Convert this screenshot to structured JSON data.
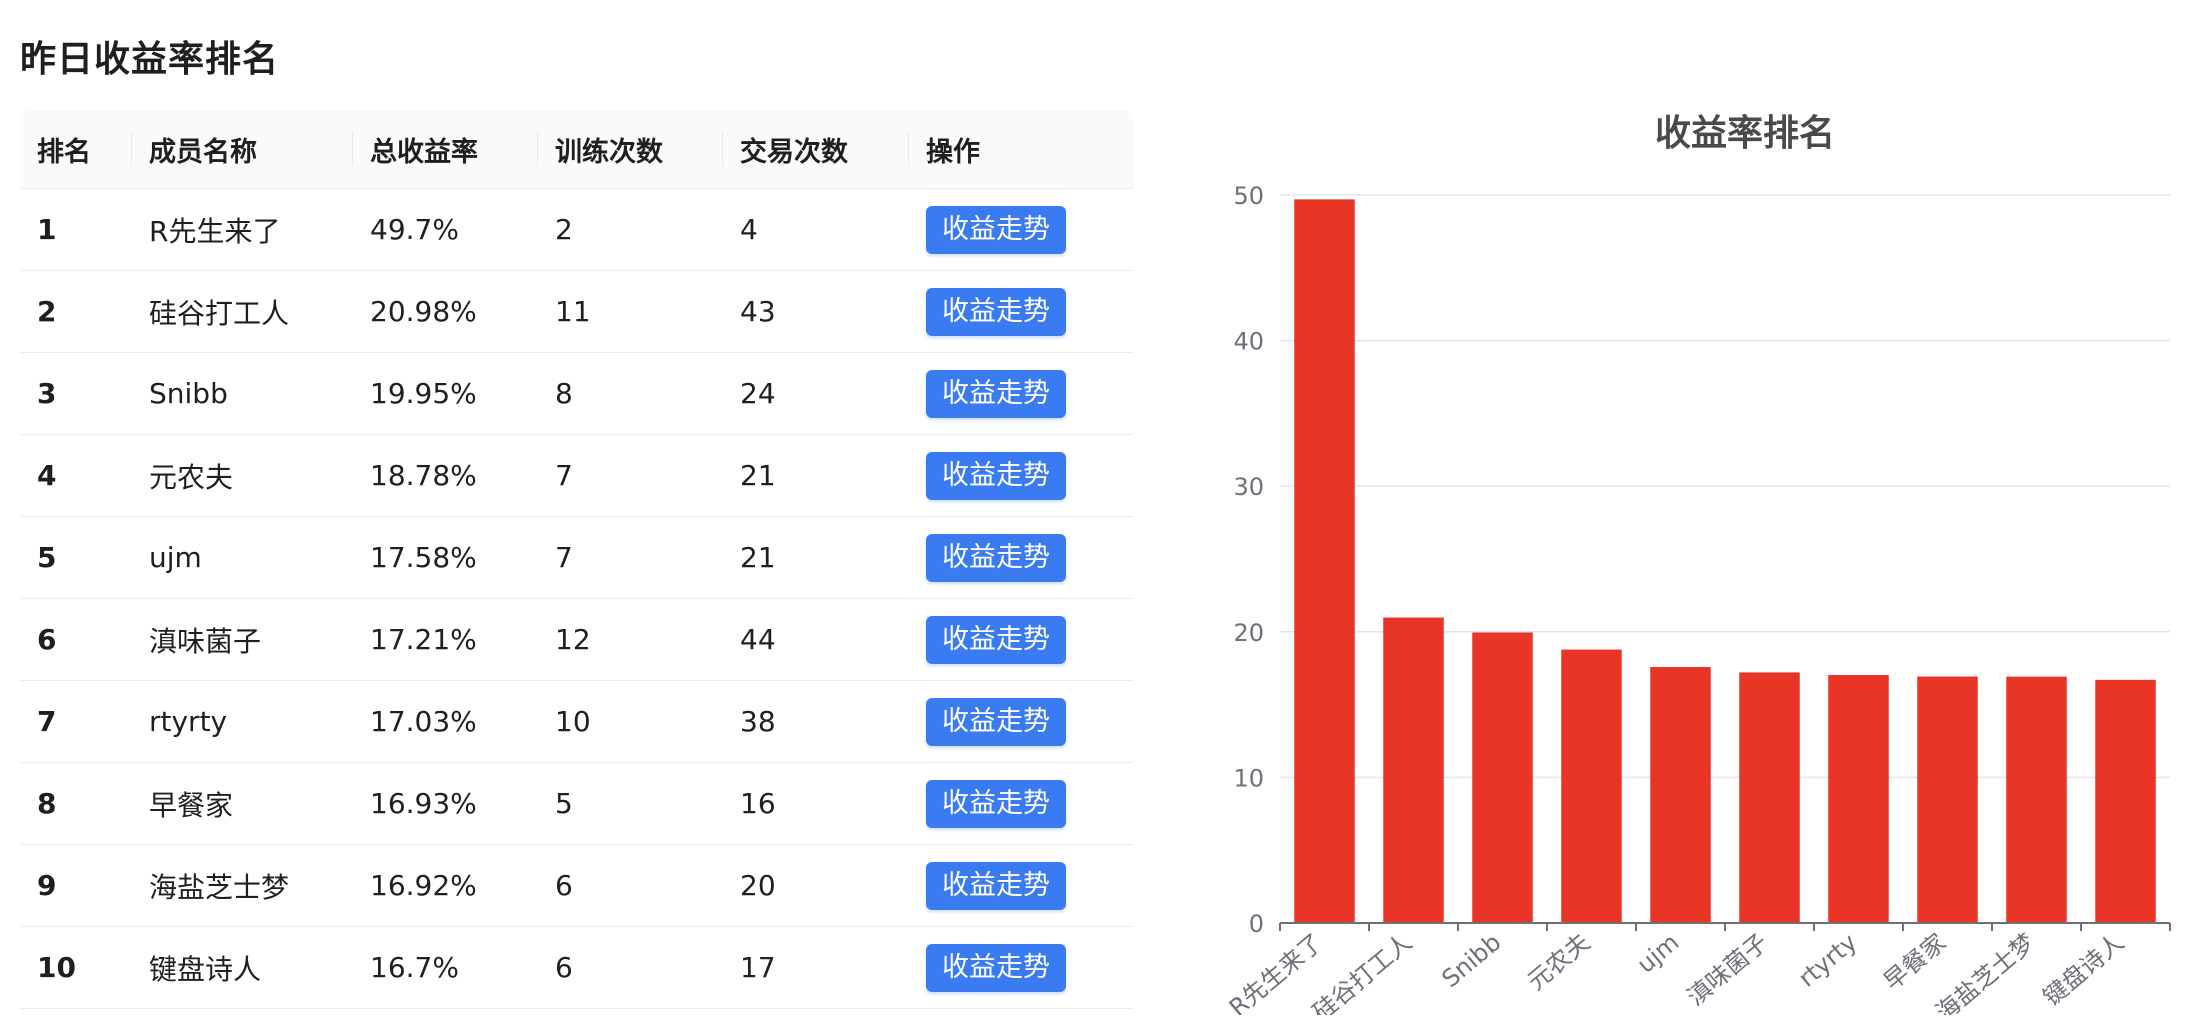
{
  "page": {
    "title": "昨日收益率排名"
  },
  "table": {
    "columns": [
      "排名",
      "成员名称",
      "总收益率",
      "训练次数",
      "交易次数",
      "操作"
    ],
    "rows": [
      {
        "rank": "1",
        "name": "R先生来了",
        "rate": "49.7%",
        "train": "2",
        "trade": "4",
        "action": "收益走势"
      },
      {
        "rank": "2",
        "name": "硅谷打工人",
        "rate": "20.98%",
        "train": "11",
        "trade": "43",
        "action": "收益走势"
      },
      {
        "rank": "3",
        "name": "Snibb",
        "rate": "19.95%",
        "train": "8",
        "trade": "24",
        "action": "收益走势"
      },
      {
        "rank": "4",
        "name": "元农夫",
        "rate": "18.78%",
        "train": "7",
        "trade": "21",
        "action": "收益走势"
      },
      {
        "rank": "5",
        "name": "ujm",
        "rate": "17.58%",
        "train": "7",
        "trade": "21",
        "action": "收益走势"
      },
      {
        "rank": "6",
        "name": "滇味菌子",
        "rate": "17.21%",
        "train": "12",
        "trade": "44",
        "action": "收益走势"
      },
      {
        "rank": "7",
        "name": "rtyrty",
        "rate": "17.03%",
        "train": "10",
        "trade": "38",
        "action": "收益走势"
      },
      {
        "rank": "8",
        "name": "早餐家",
        "rate": "16.93%",
        "train": "5",
        "trade": "16",
        "action": "收益走势"
      },
      {
        "rank": "9",
        "name": "海盐芝士梦",
        "rate": "16.92%",
        "train": "6",
        "trade": "20",
        "action": "收益走势"
      },
      {
        "rank": "10",
        "name": "键盘诗人",
        "rate": "16.7%",
        "train": "6",
        "trade": "17",
        "action": "收益走势"
      }
    ]
  },
  "colors": {
    "rank_text": "#3a7ef2",
    "rate_text": "#e5312e",
    "button_bg": "#3b7bf2",
    "bar_fill": "#e83526"
  },
  "chart_data": {
    "type": "bar",
    "title": "收益率排名",
    "categories": [
      "R先生来了",
      "硅谷打工人",
      "Snibb",
      "元农夫",
      "ujm",
      "滇味菌子",
      "rtyrty",
      "早餐家",
      "海盐芝士梦",
      "键盘诗人"
    ],
    "values": [
      49.7,
      20.98,
      19.95,
      18.78,
      17.58,
      17.21,
      17.03,
      16.93,
      16.92,
      16.7
    ],
    "yticks": [
      0,
      10,
      20,
      30,
      40,
      50
    ],
    "ylim": [
      0,
      50
    ],
    "grid": true,
    "xlabel": "",
    "ylabel": ""
  }
}
